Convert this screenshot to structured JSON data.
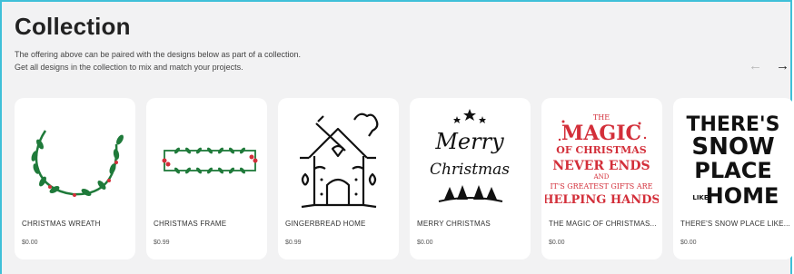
{
  "section": {
    "title": "Collection",
    "subtitle_line1": "The offering above can be paired with the designs below as part of a collection.",
    "subtitle_line2": "Get all designs in the collection to mix and match your projects."
  },
  "nav": {
    "prev_icon": "arrow-left-icon",
    "next_icon": "arrow-right-icon"
  },
  "colors": {
    "frame": "#3fc0d8",
    "green": "#1f7a3a",
    "red": "#d32f3a",
    "black": "#111111"
  },
  "products": [
    {
      "name": "CHRISTMAS WREATH",
      "price": "$0.00"
    },
    {
      "name": "CHRISTMAS FRAME",
      "price": "$0.99"
    },
    {
      "name": "GINGERBREAD HOME",
      "price": "$0.99"
    },
    {
      "name": "MERRY CHRISTMAS",
      "price": "$0.00"
    },
    {
      "name": "THE MAGIC OF CHRISTMAS...",
      "price": "$0.00"
    },
    {
      "name": "THERE'S SNOW PLACE LIKE...",
      "price": "$0.00"
    }
  ],
  "artwork_text": {
    "merry": "Merry",
    "christmas": "Christmas",
    "magic": [
      "THE",
      "MAGIC",
      "OF CHRISTMAS",
      "NEVER ENDS",
      "AND",
      "IT'S GREATEST GIFTS ARE",
      "HELPING HANDS"
    ],
    "snow": [
      "THERE'S",
      "SNOW",
      "PLACE",
      "LIKE",
      "HOME"
    ]
  }
}
